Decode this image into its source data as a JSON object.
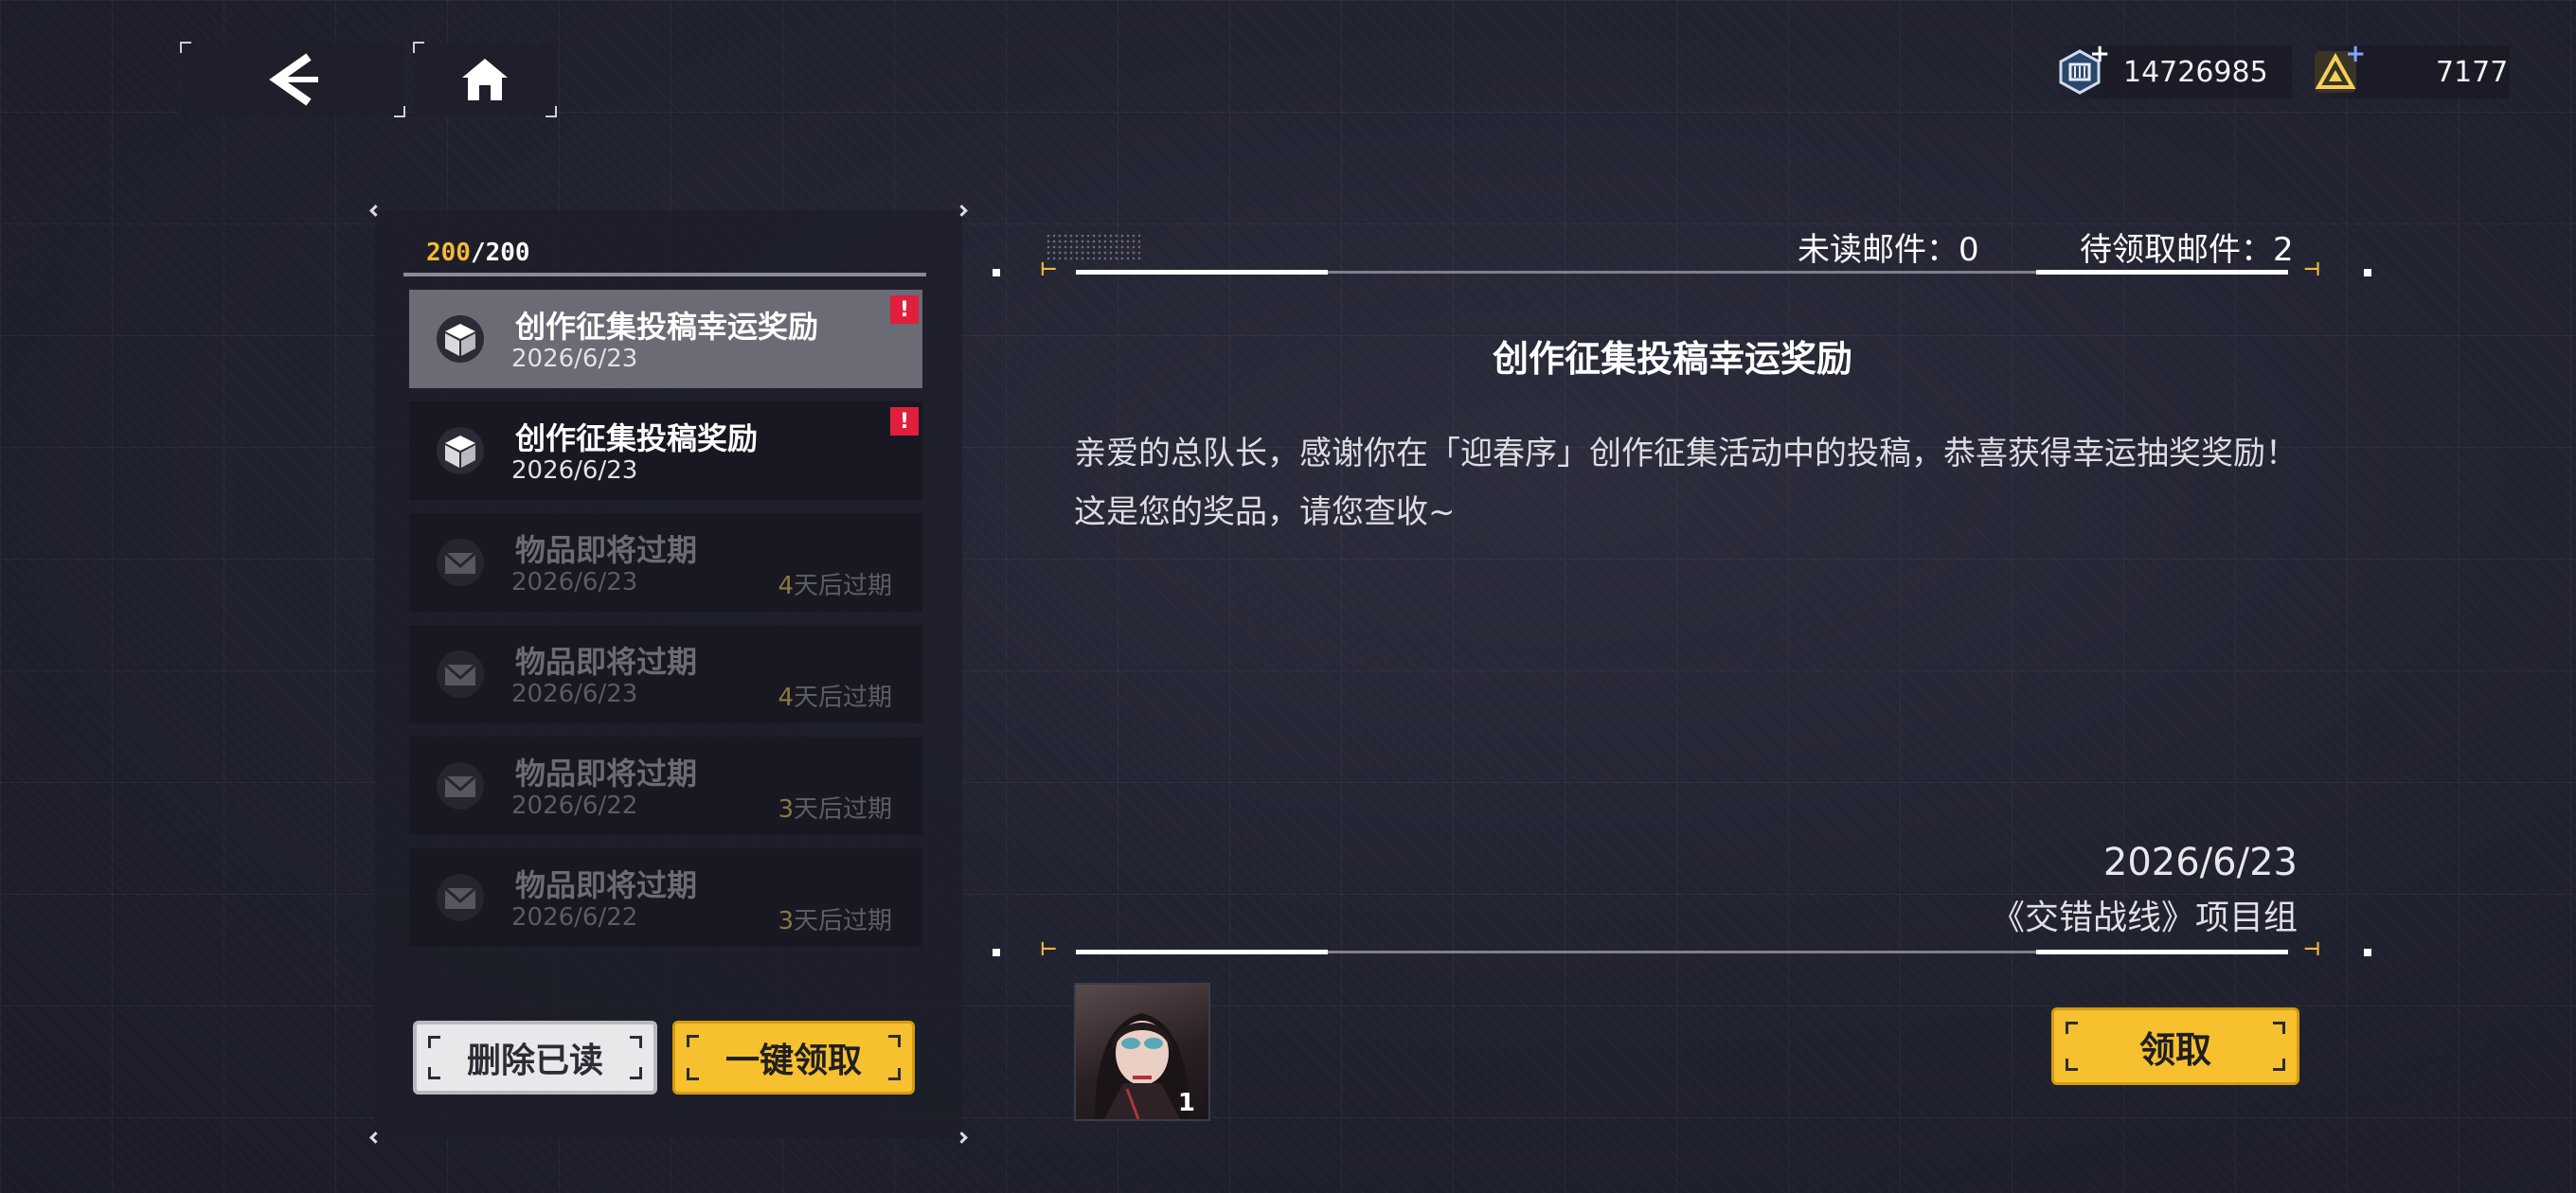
{
  "nav": {
    "back_icon": "back-arrow-icon",
    "home_icon": "home-icon"
  },
  "currency": [
    {
      "icon": "credits-chip-icon",
      "value": "14726985"
    },
    {
      "icon": "triangle-crystal-icon",
      "value": "7177"
    }
  ],
  "mailbox": {
    "count_current": "200",
    "count_sep": "/",
    "count_max": "200",
    "items": [
      {
        "title": "创作征集投稿幸运奖励",
        "date": "2026/6/23",
        "icon": "package-box-icon",
        "badge": "!",
        "expire_num": "",
        "expire_suffix": ""
      },
      {
        "title": "创作征集投稿奖励",
        "date": "2026/6/23",
        "icon": "package-box-icon",
        "badge": "!",
        "expire_num": "",
        "expire_suffix": ""
      },
      {
        "title": "物品即将过期",
        "date": "2026/6/23",
        "icon": "envelope-icon",
        "badge": "",
        "expire_num": "4",
        "expire_suffix": "天后过期"
      },
      {
        "title": "物品即将过期",
        "date": "2026/6/23",
        "icon": "envelope-icon",
        "badge": "",
        "expire_num": "4",
        "expire_suffix": "天后过期"
      },
      {
        "title": "物品即将过期",
        "date": "2026/6/22",
        "icon": "envelope-icon",
        "badge": "",
        "expire_num": "3",
        "expire_suffix": "天后过期"
      },
      {
        "title": "物品即将过期",
        "date": "2026/6/22",
        "icon": "envelope-icon",
        "badge": "",
        "expire_num": "3",
        "expire_suffix": "天后过期"
      }
    ],
    "delete_read_label": "删除已读",
    "claim_all_label": "一键领取"
  },
  "stats": {
    "unread": "未读邮件：0",
    "pending": "待领取邮件：2"
  },
  "detail": {
    "title": "创作征集投稿幸运奖励",
    "body": "亲爱的总队长，感谢你在「迎春序」创作征集活动中的投稿，恭喜获得幸运抽奖奖励！这是您的奖品，请您查收~",
    "date": "2026/6/23",
    "sender": "《交错战线》项目组",
    "reward_count": "1",
    "claim_label": "领取"
  },
  "colors": {
    "accent_gold": "#f6c02e",
    "badge_red": "#e01f3c",
    "count_gold": "#f6b93a"
  }
}
